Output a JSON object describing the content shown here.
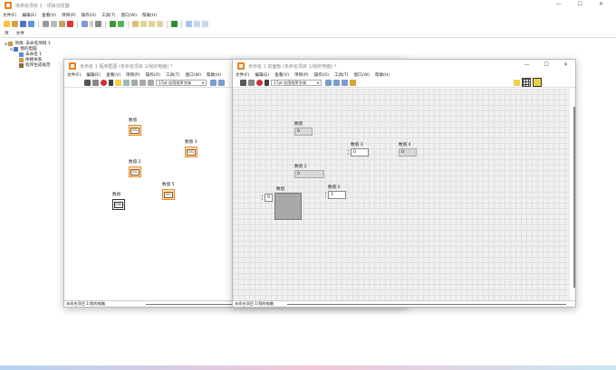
{
  "project_window": {
    "title": "未命名项目 1 - 项目浏览器",
    "menu": [
      "文件(F)",
      "编辑(E)",
      "查看(V)",
      "项目(P)",
      "操作(O)",
      "工具(T)",
      "窗口(W)",
      "帮助(H)"
    ],
    "tabs": [
      "项",
      "文件"
    ],
    "tree": [
      {
        "label": "项目: 未命名项目 1",
        "level": 0
      },
      {
        "label": "我的电脑",
        "level": 1
      },
      {
        "label": "未命名 1",
        "level": 2
      },
      {
        "label": "依赖关系",
        "level": 2
      },
      {
        "label": "程序生成规范",
        "level": 2
      }
    ]
  },
  "block_diagram": {
    "title": "未命名 1 程序框图 (未命名项目 1/我的电脑) *",
    "menu": [
      "文件(F)",
      "编辑(E)",
      "查看(V)",
      "项目(P)",
      "操作(O)",
      "工具(T)",
      "窗口(W)",
      "帮助(H)"
    ],
    "font": "17pt 应用程序字体",
    "status": "未命名项目 1/我的电脑",
    "terminals": [
      {
        "label": "数值",
        "value": "DBL"
      },
      {
        "label": "数值 3",
        "value": "DBL"
      },
      {
        "label": "数值 2",
        "value": "DBL"
      },
      {
        "label": "数值 5",
        "value": "DBL"
      },
      {
        "label": "数组",
        "value": "[DBL]"
      }
    ]
  },
  "front_panel": {
    "title": "未命名 1 前面板 (未命名项目 1/我的电脑) *",
    "menu": [
      "文件(F)",
      "编辑(E)",
      "查看(V)",
      "项目(P)",
      "操作(O)",
      "工具(T)",
      "窗口(W)",
      "帮助(H)"
    ],
    "font": "17pt 应用程序字体",
    "status": "未命名项目 1/我的电脑",
    "controls": {
      "num": {
        "label": "数值",
        "value": "0"
      },
      "num2": {
        "label": "数值 2",
        "value": "0"
      },
      "num3": {
        "label": "数值 3",
        "value": "0"
      },
      "num4": {
        "label": "数值 4",
        "value": "0"
      },
      "num5": {
        "label": "数值 5",
        "value": "1"
      },
      "array": {
        "label": "数组",
        "index": "0"
      }
    }
  },
  "colors": {
    "accent": "#e8821e",
    "grid_bg": "#f0f0f0",
    "indicator": "#d8d8d8"
  }
}
